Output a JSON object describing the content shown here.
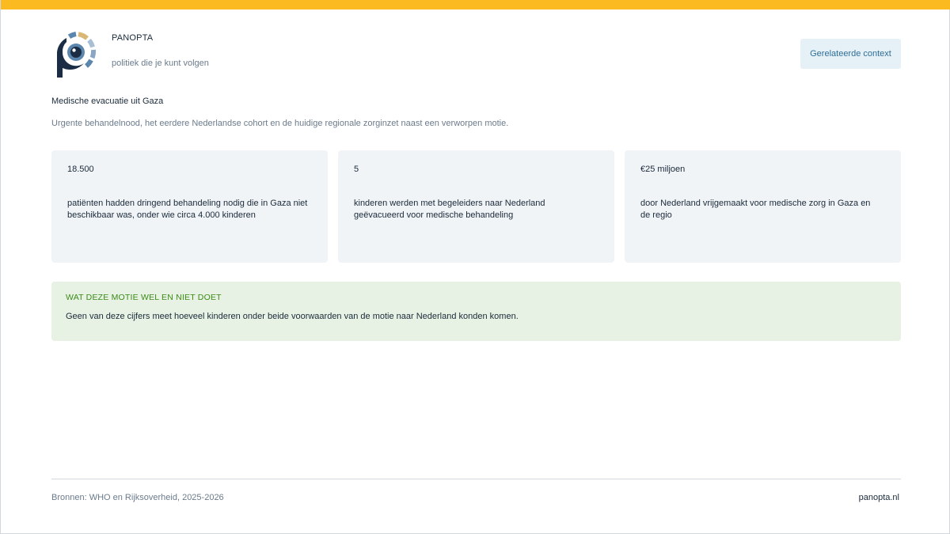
{
  "header": {
    "brand": "PANOPTA",
    "tagline": "politiek die je kunt volgen",
    "context_button": "Gerelateerde context"
  },
  "topic": {
    "title": "Medische evacuatie uit Gaza",
    "subtitle": "Urgente behandelnood, het eerdere Nederlandse cohort en de huidige regionale zorginzet naast een verworpen motie."
  },
  "stats": [
    {
      "value": "18.500",
      "description": "patiënten hadden dringend behandeling nodig die in Gaza niet beschikbaar was, onder wie circa 4.000 kinderen"
    },
    {
      "value": "5",
      "description": "kinderen werden met begeleiders naar Nederland geëvacueerd voor medische behandeling"
    },
    {
      "value": "€25 miljoen",
      "description": "door Nederland vrijgemaakt voor medische zorg in Gaza en de regio"
    }
  ],
  "note": {
    "heading": "WAT DEZE MOTIE WEL EN NIET DOET",
    "text": "Geen van deze cijfers meet hoeveel kinderen onder beide voorwaarden van de motie naar Nederland konden komen."
  },
  "footer": {
    "sources": "Bronnen: WHO en Rijksoverheid, 2025-2026",
    "site": "panopta.nl"
  },
  "colors": {
    "accent_bar": "#fbba1f",
    "logo_navy": "#1b2d45",
    "logo_blue": "#5b86ad",
    "logo_gold": "#d9b876",
    "note_background": "#e7f2e4",
    "note_heading": "#3b8a16",
    "card_background": "#f1f4f7",
    "button_background": "#e6f0f7"
  }
}
